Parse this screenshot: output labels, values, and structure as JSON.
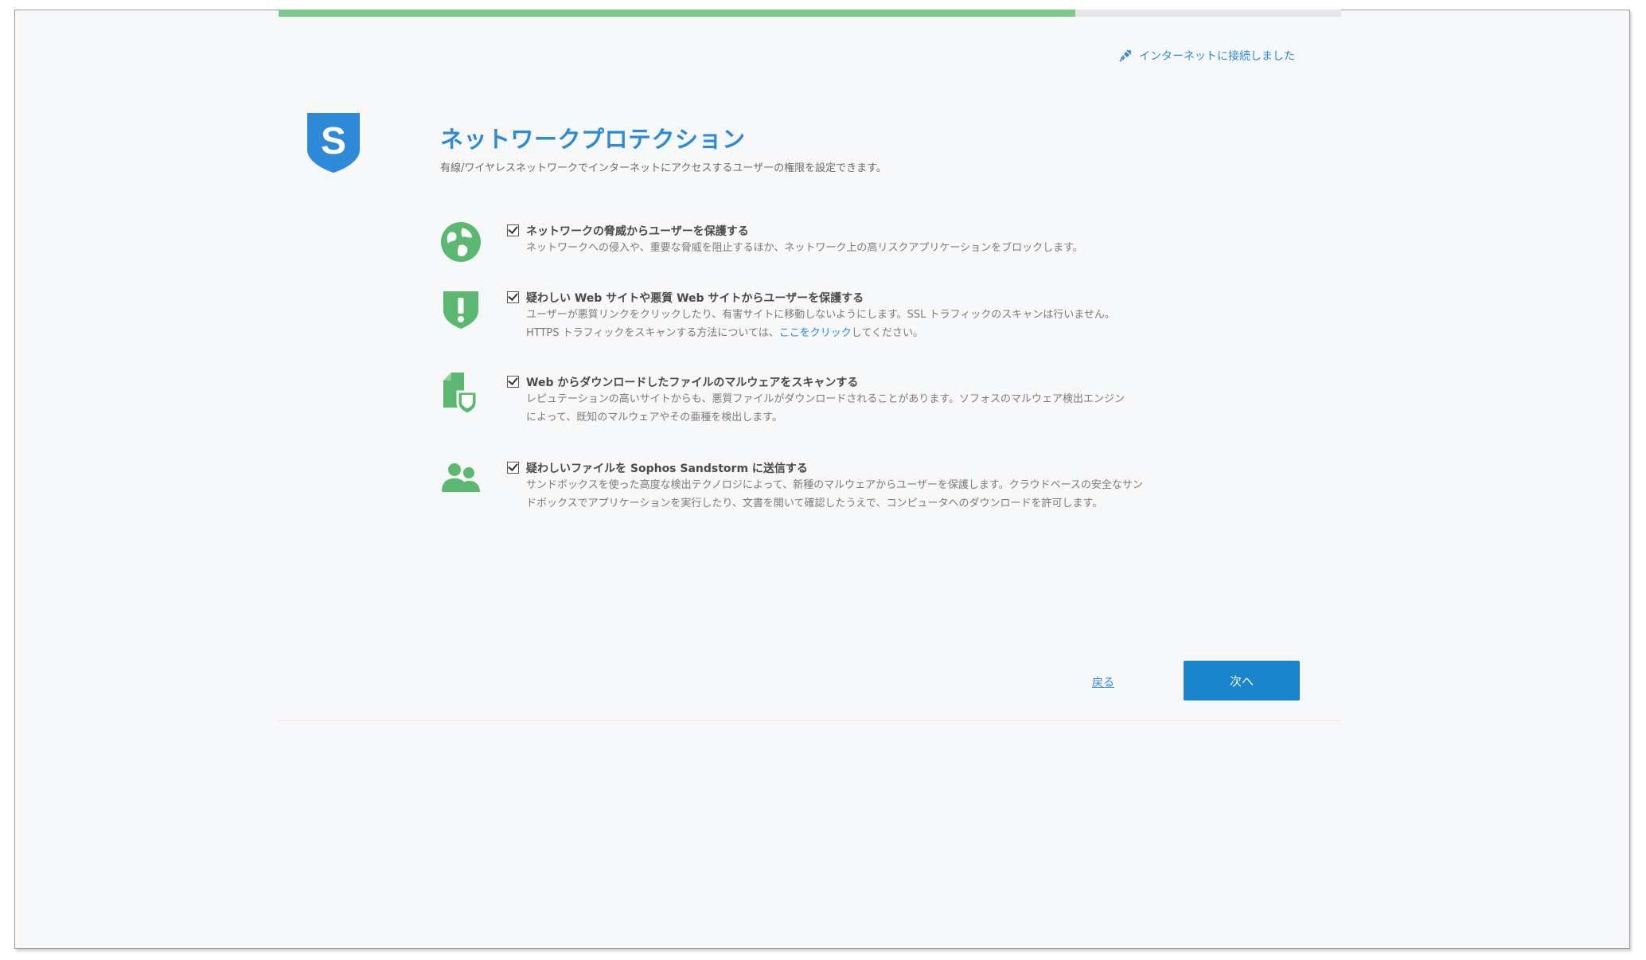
{
  "progress": {
    "fraction": 0.75
  },
  "header": {
    "net_status": "インターネットに接続しました",
    "net_icon": "plug-connected-icon"
  },
  "page": {
    "logo_letter": "S",
    "title": "ネットワークプロテクション",
    "subtitle": "有線/ワイヤレスネットワークでインターネットにアクセスするユーザーの権限を設定できます。"
  },
  "options": [
    {
      "icon": "globe-icon",
      "checked": true,
      "title": "ネットワークの脅威からユーザーを保護する",
      "desc1": "ネットワークへの侵入や、重要な脅威を阻止するほか、ネットワーク上の高リスクアプリケーションをブロックします。"
    },
    {
      "icon": "shield-alert-icon",
      "checked": true,
      "title": "疑わしい Web サイトや悪質 Web サイトからユーザーを保護する",
      "desc1": "ユーザーが悪質リンクをクリックしたり、有害サイトに移動しないようにします。SSL トラフィックのスキャンは行いません。",
      "desc2": "HTTPS トラフィックをスキャンする方法については、",
      "desc2_link": "ここをクリック",
      "desc2_tail": "してください。"
    },
    {
      "icon": "file-shield-icon",
      "checked": true,
      "title": "Web からダウンロードしたファイルのマルウェアをスキャンする",
      "desc1": "レピュテーションの高いサイトからも、悪質ファイルがダウンロードされることがあります。ソフォスのマルウェア検出エンジン",
      "desc2": "によって、既知のマルウェアやその亜種を検出します。"
    },
    {
      "icon": "users-icon",
      "checked": true,
      "title": "疑わしいファイルを Sophos Sandstorm に送信する",
      "desc1": "サンドボックスを使った高度な検出テクノロジによって、新種のマルウェアからユーザーを保護します。クラウドベースの安全なサン",
      "desc2": "ドボックスでアプリケーションを実行したり、文書を開いて確認したうえで、コンピュータへのダウンロードを許可します。"
    }
  ],
  "footer": {
    "back_label": "戻る",
    "next_label": "次へ"
  },
  "colors": {
    "accent": "#2e8ad8",
    "icon_green": "#5cb870",
    "progress_green": "#7cc98a",
    "button_blue": "#1a84cc"
  }
}
